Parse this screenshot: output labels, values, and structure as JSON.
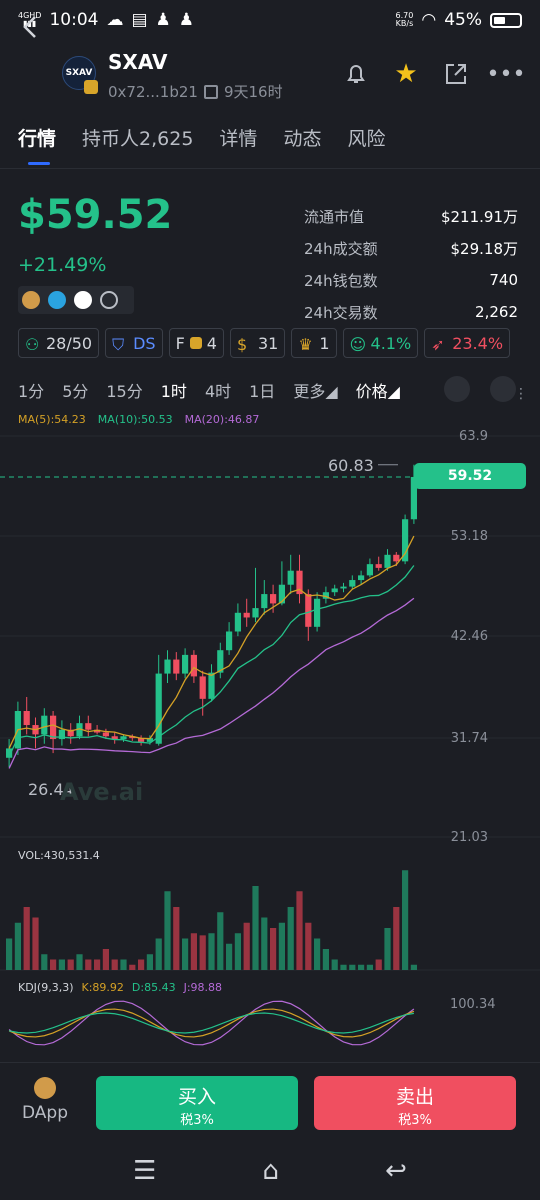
{
  "status_bar": {
    "network": "4GHD",
    "time": "10:04",
    "speed": "6.70",
    "speed_unit": "KB/s",
    "battery": "45%"
  },
  "token": {
    "name": "SXAV",
    "logo_text": "SXAV",
    "address": "0x72...1b21",
    "age": "9天16时"
  },
  "tabs": [
    {
      "label": "行情"
    },
    {
      "label": "持币人2,625"
    },
    {
      "label": "详情"
    },
    {
      "label": "动态"
    },
    {
      "label": "风险"
    }
  ],
  "price": {
    "value": "$59.52",
    "change": "+21.49%"
  },
  "stats": [
    {
      "label": "流通市值",
      "value": "$211.91万"
    },
    {
      "label": "24h成交额",
      "value": "$29.18万"
    },
    {
      "label": "24h钱包数",
      "value": "740"
    },
    {
      "label": "24h交易数",
      "value": "2,262"
    }
  ],
  "badges": [
    {
      "icon": "holders-icon",
      "text": "28/50",
      "color": "#d2d5db"
    },
    {
      "icon": "ds-icon",
      "text": "DS",
      "color": "#5b8cff"
    },
    {
      "icon": "f-icon",
      "text": "4",
      "prefix": "F",
      "color": "#d2d5db"
    },
    {
      "icon": "moneybag-icon",
      "text": "31",
      "color": "#d2d5db"
    },
    {
      "icon": "trophy-icon",
      "text": "1",
      "color": "#d2d5db"
    },
    {
      "icon": "smile-icon",
      "text": "4.1%",
      "color": "#24c18a"
    },
    {
      "icon": "rocket-icon",
      "text": "23.4%",
      "color": "#f04f60"
    }
  ],
  "timeframes": [
    {
      "label": "1分"
    },
    {
      "label": "5分"
    },
    {
      "label": "15分"
    },
    {
      "label": "1时"
    },
    {
      "label": "4时"
    },
    {
      "label": "1日"
    },
    {
      "label": "更多"
    },
    {
      "label": "价格"
    }
  ],
  "ma": [
    {
      "label": "MA(5):54.23",
      "color": "#d4a126"
    },
    {
      "label": "MA(10):50.53",
      "color": "#24c18a"
    },
    {
      "label": "MA(20):46.87",
      "color": "#b46ad6"
    }
  ],
  "chart": {
    "axis": [
      "63.9",
      "53.18",
      "42.46",
      "31.74",
      "21.03"
    ],
    "current_price": "59.52",
    "high_label": "60.83",
    "low_label": "26.44",
    "watermark": "Ave.ai",
    "volume_label": "VOL:430,531.4",
    "kdj": [
      {
        "label": "KDJ(9,3,3)",
        "color": "#d2d5db"
      },
      {
        "label": "K:89.92",
        "color": "#d4a126"
      },
      {
        "label": "D:85.43",
        "color": "#24c18a"
      },
      {
        "label": "J:98.88",
        "color": "#b46ad6"
      }
    ],
    "kdj_axis": "100.34"
  },
  "chart_data": {
    "type": "candlestick",
    "yaxis_ticks": [
      63.9,
      53.18,
      42.46,
      31.74,
      21.03
    ],
    "candles": [
      {
        "o": 29.5,
        "c": 30.5,
        "h": 31.5,
        "l": 28.5
      },
      {
        "o": 30.5,
        "c": 34.5,
        "h": 35.5,
        "l": 29.8
      },
      {
        "o": 34.5,
        "c": 33.0,
        "h": 36.0,
        "l": 32.0
      },
      {
        "o": 33.0,
        "c": 32.0,
        "h": 33.8,
        "l": 30.5
      },
      {
        "o": 32.0,
        "c": 34.0,
        "h": 34.8,
        "l": 31.0
      },
      {
        "o": 34.0,
        "c": 31.5,
        "h": 34.5,
        "l": 30.0
      },
      {
        "o": 31.5,
        "c": 32.5,
        "h": 33.5,
        "l": 30.8
      },
      {
        "o": 32.5,
        "c": 31.8,
        "h": 33.2,
        "l": 31.0
      },
      {
        "o": 31.8,
        "c": 33.2,
        "h": 34.0,
        "l": 31.5
      },
      {
        "o": 33.2,
        "c": 32.5,
        "h": 34.0,
        "l": 31.8
      },
      {
        "o": 32.5,
        "c": 32.2,
        "h": 33.0,
        "l": 32.0
      },
      {
        "o": 32.2,
        "c": 31.8,
        "h": 32.6,
        "l": 31.5
      },
      {
        "o": 31.8,
        "c": 31.5,
        "h": 32.2,
        "l": 31.0
      },
      {
        "o": 31.5,
        "c": 31.8,
        "h": 32.0,
        "l": 31.2
      },
      {
        "o": 31.8,
        "c": 31.6,
        "h": 32.0,
        "l": 31.3
      },
      {
        "o": 31.6,
        "c": 31.2,
        "h": 31.9,
        "l": 30.8
      },
      {
        "o": 31.2,
        "c": 31.6,
        "h": 31.9,
        "l": 30.9
      },
      {
        "o": 31.0,
        "c": 38.5,
        "h": 40.5,
        "l": 30.8
      },
      {
        "o": 38.5,
        "c": 40.0,
        "h": 41.0,
        "l": 37.5
      },
      {
        "o": 40.0,
        "c": 38.5,
        "h": 40.8,
        "l": 37.8
      },
      {
        "o": 38.5,
        "c": 40.5,
        "h": 41.2,
        "l": 38.0
      },
      {
        "o": 40.5,
        "c": 38.2,
        "h": 41.0,
        "l": 37.5
      },
      {
        "o": 38.2,
        "c": 35.8,
        "h": 38.8,
        "l": 34.0
      },
      {
        "o": 35.8,
        "c": 38.6,
        "h": 39.5,
        "l": 35.5
      },
      {
        "o": 38.6,
        "c": 41.0,
        "h": 41.8,
        "l": 38.0
      },
      {
        "o": 41.0,
        "c": 43.0,
        "h": 44.0,
        "l": 40.5
      },
      {
        "o": 43.0,
        "c": 45.0,
        "h": 46.0,
        "l": 42.5
      },
      {
        "o": 45.0,
        "c": 44.5,
        "h": 46.5,
        "l": 43.5
      },
      {
        "o": 44.5,
        "c": 45.5,
        "h": 49.8,
        "l": 44.0
      },
      {
        "o": 45.5,
        "c": 47.0,
        "h": 48.5,
        "l": 44.8
      },
      {
        "o": 47.0,
        "c": 46.0,
        "h": 48.0,
        "l": 45.0
      },
      {
        "o": 46.0,
        "c": 48.0,
        "h": 50.5,
        "l": 45.8
      },
      {
        "o": 48.0,
        "c": 49.5,
        "h": 51.2,
        "l": 47.0
      },
      {
        "o": 49.5,
        "c": 47.0,
        "h": 51.2,
        "l": 46.0
      },
      {
        "o": 47.0,
        "c": 43.5,
        "h": 47.5,
        "l": 42.0
      },
      {
        "o": 43.5,
        "c": 46.5,
        "h": 47.2,
        "l": 43.0
      },
      {
        "o": 46.5,
        "c": 47.2,
        "h": 47.8,
        "l": 46.0
      },
      {
        "o": 47.2,
        "c": 47.6,
        "h": 48.0,
        "l": 46.8
      },
      {
        "o": 47.6,
        "c": 47.8,
        "h": 48.2,
        "l": 47.2
      },
      {
        "o": 47.8,
        "c": 48.5,
        "h": 49.0,
        "l": 47.5
      },
      {
        "o": 48.5,
        "c": 49.0,
        "h": 49.5,
        "l": 48.0
      },
      {
        "o": 49.0,
        "c": 50.2,
        "h": 50.8,
        "l": 48.8
      },
      {
        "o": 50.2,
        "c": 49.8,
        "h": 51.0,
        "l": 49.5
      },
      {
        "o": 49.8,
        "c": 51.2,
        "h": 51.8,
        "l": 49.5
      },
      {
        "o": 51.2,
        "c": 50.5,
        "h": 51.5,
        "l": 50.0
      },
      {
        "o": 50.5,
        "c": 55.0,
        "h": 55.5,
        "l": 50.2
      },
      {
        "o": 55.0,
        "c": 59.52,
        "h": 60.83,
        "l": 54.5
      }
    ],
    "volumes": [
      0.3,
      0.45,
      0.6,
      0.5,
      0.15,
      0.1,
      0.1,
      0.1,
      0.15,
      0.1,
      0.1,
      0.2,
      0.1,
      0.1,
      0.05,
      0.1,
      0.15,
      0.3,
      0.75,
      0.6,
      0.3,
      0.35,
      0.33,
      0.35,
      0.55,
      0.25,
      0.35,
      0.45,
      0.8,
      0.5,
      0.4,
      0.45,
      0.6,
      0.75,
      0.45,
      0.3,
      0.2,
      0.1,
      0.05,
      0.05,
      0.05,
      0.05,
      0.1,
      0.4,
      0.6,
      0.95,
      0.05
    ]
  },
  "bottom": {
    "dapp": "DApp",
    "buy": "买入",
    "buy_tax": "税3%",
    "sell": "卖出",
    "sell_tax": "税3%"
  }
}
